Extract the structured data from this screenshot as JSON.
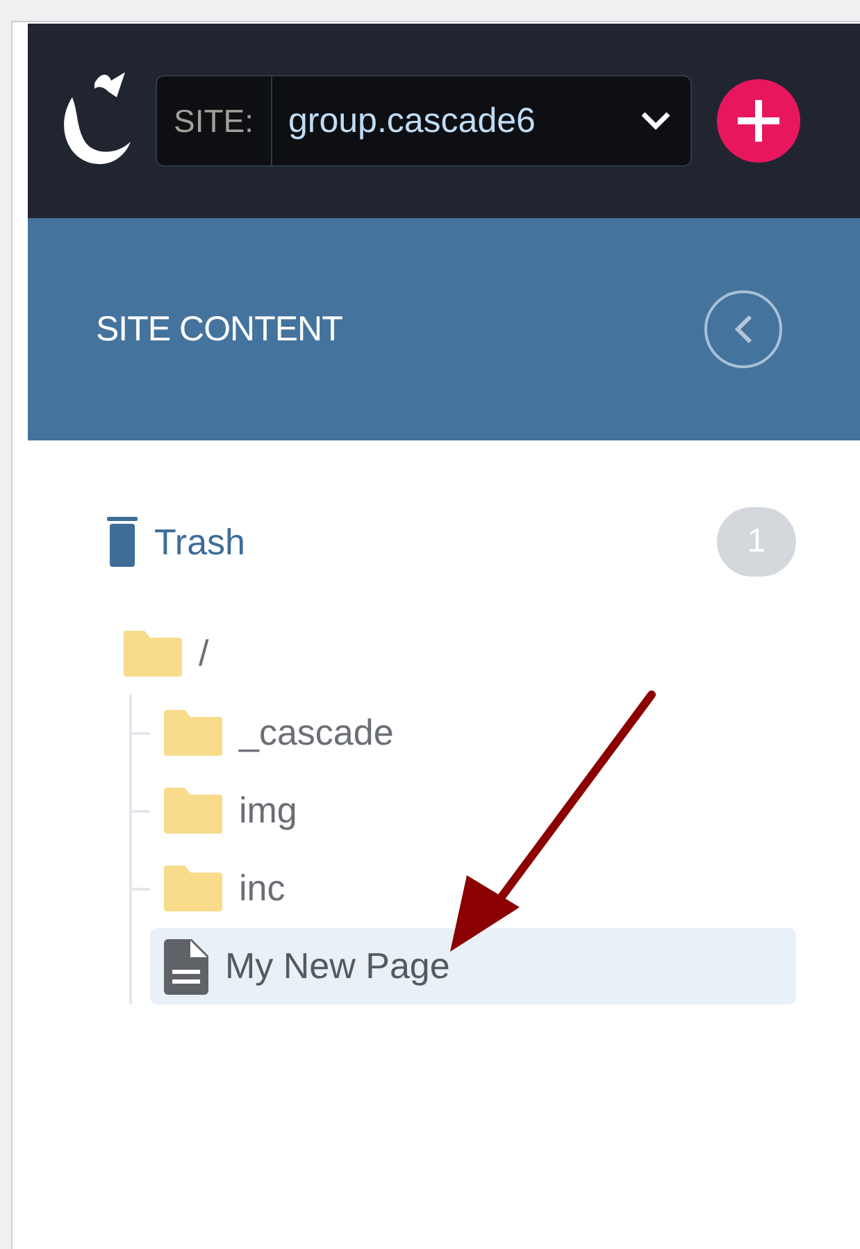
{
  "header": {
    "site_label": "SITE:",
    "site_value": "group.cascade6"
  },
  "panel": {
    "title": "SITE CONTENT"
  },
  "trash": {
    "label": "Trash",
    "count": "1"
  },
  "tree": {
    "label": "/",
    "kind": "folder",
    "selected": false,
    "children": [
      {
        "label": "_cascade",
        "kind": "folder",
        "selected": false
      },
      {
        "label": "img",
        "kind": "folder",
        "selected": false
      },
      {
        "label": "inc",
        "kind": "folder",
        "selected": false
      },
      {
        "label": "My New Page",
        "kind": "page",
        "selected": true
      }
    ]
  }
}
